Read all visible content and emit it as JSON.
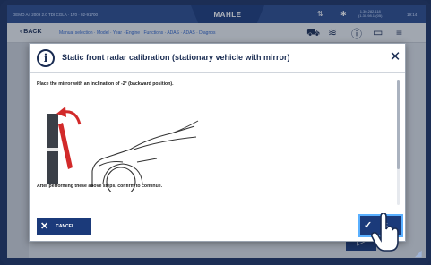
{
  "statusbar": {
    "vehicle": "DEMO A4 2009 2.0 TDI CGLA · 170 · 02-91700",
    "brand": "MAHLE",
    "coords": "1.30.282.118\n(1.30.98.1)(05)",
    "time": "19:14"
  },
  "navbar": {
    "back_label": "BACK",
    "breadcrumbs": "Manual selection · Model · Year · Engine · Functions · ADAS · ADAS · Diagnos"
  },
  "dialog": {
    "title": "Static front radar calibration (stationary vehicle with mirror)",
    "instruction": "Place the mirror with an inclination of -2° (backward position).",
    "confirm_text": "After performing these above steps, confirm to continue.",
    "cancel_label": "CANCEL",
    "ok_label": "OK"
  },
  "icons": {
    "info": "info-icon",
    "close": "close-icon",
    "cancel": "x-icon",
    "ok": "check-icon",
    "pointer": "hand-pointer-icon"
  },
  "colors": {
    "brand_dark": "#1b3a7a",
    "mirror_accent": "#d22a2a",
    "focus": "#5ab0ff"
  }
}
